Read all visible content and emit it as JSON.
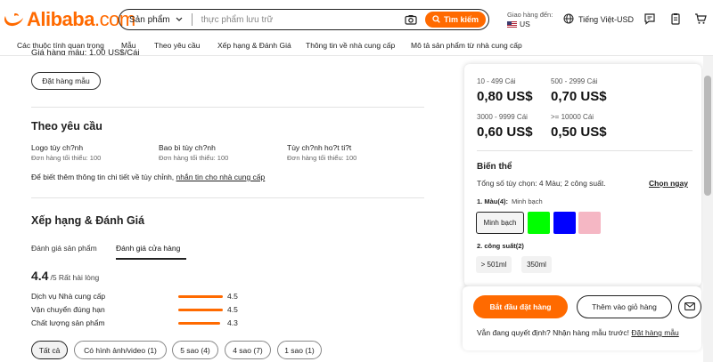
{
  "header": {
    "logo_text": "Alibaba",
    "logo_suffix": ".com",
    "search": {
      "category": "Sản phẩm",
      "placeholder": "thực phẩm lưu trữ",
      "button_label": "Tìm kiếm"
    },
    "ship_to_label": "Giao hàng đến:",
    "ship_to_country": "US",
    "language": "Tiếng Việt-USD"
  },
  "nav": {
    "items": [
      {
        "label": "Các thuộc tính quan trọng"
      },
      {
        "label": "Mẫu"
      },
      {
        "label": "Theo yêu cầu"
      },
      {
        "label": "Xếp hạng & Đánh Giá"
      },
      {
        "label": "Thông tin về nhà cung cấp"
      },
      {
        "label": "Mô tả sản phẩm từ nhà cung cấp"
      }
    ]
  },
  "sample": {
    "cut_text": "Giá hàng mẫu: 1,00 US$/Cái",
    "order_button": "Đặt hàng mẫu"
  },
  "customize": {
    "title": "Theo yêu cầu",
    "options": [
      {
        "name": "Logo tùy ch?nh",
        "min": "Đơn hàng tối thiểu: 100"
      },
      {
        "name": "Bao bì tùy ch?nh",
        "min": "Đơn hàng tối thiểu: 100"
      },
      {
        "name": "Tùy ch?nh ho?t ti?t",
        "min": "Đơn hàng tối thiểu: 100"
      }
    ],
    "note": "Để biết thêm thông tin chi tiết về tùy chỉnh,",
    "note_link": "nhắn tin cho nhà cung cấp"
  },
  "reviews": {
    "title": "Xếp hạng & Đánh Giá",
    "tabs": [
      {
        "label": "Đánh giá sản phẩm"
      },
      {
        "label": "Đánh giá cửa hàng"
      }
    ],
    "score": "4.4",
    "score_suffix": "/5 Rất hài lòng",
    "metrics": [
      {
        "label": "Dịch vụ Nhà cung cấp",
        "value": "4.5",
        "fraction": 0.9
      },
      {
        "label": "Vận chuyển đúng hạn",
        "value": "4.5",
        "fraction": 0.9
      },
      {
        "label": "Chất lượng sản phẩm",
        "value": "4.3",
        "fraction": 0.86
      }
    ],
    "filters": [
      {
        "label": "Tất cả"
      },
      {
        "label": "Có hình ảnh/video (1)"
      },
      {
        "label": "5 sao (4)"
      },
      {
        "label": "4 sao (7)"
      },
      {
        "label": "1 sao (1)"
      }
    ]
  },
  "pricing": {
    "tiers": [
      {
        "range": "10 - 499 Cái",
        "price": "0,80 US$"
      },
      {
        "range": "500 - 2999 Cái",
        "price": "0,70 US$"
      },
      {
        "range": "3000 - 9999 Cái",
        "price": "0,60 US$"
      },
      {
        "range": ">= 10000 Cái",
        "price": "0,50 US$"
      }
    ]
  },
  "variants": {
    "title": "Biến thể",
    "summary": "Tổng số tùy chọn: 4 Màu; 2 công suất.",
    "select_now": "Chọn ngay",
    "color_label": "1. Màu(4):",
    "color_selected": "Minh bạch",
    "colors": [
      {
        "name": "Minh bạch"
      },
      {
        "name": "green",
        "hex": "#00ff00"
      },
      {
        "name": "blue",
        "hex": "#0000ff"
      },
      {
        "name": "pink",
        "hex": "#f5b7c4"
      }
    ],
    "capacity_label": "2. công suất(2)",
    "capacities": [
      {
        "label": "> 501ml"
      },
      {
        "label": "350ml"
      }
    ]
  },
  "cart": {
    "start_order": "Bắt đầu đặt hàng",
    "add_to_cart": "Thêm vào giỏ hàng",
    "undecided": "Vẫn đang quyết định? Nhận hàng mẫu trước!",
    "sample_link": "Đặt hàng mẫu"
  },
  "colors": {
    "accent": "#ff6a00"
  }
}
